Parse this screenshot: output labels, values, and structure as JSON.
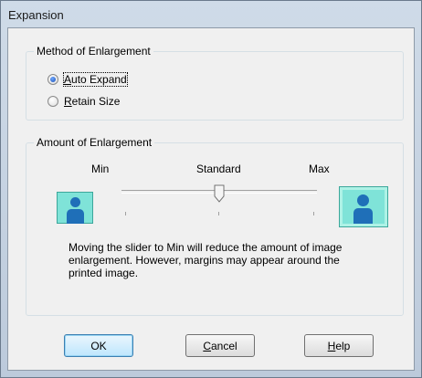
{
  "window": {
    "title": "Expansion"
  },
  "method_group": {
    "legend": "Method of Enlargement",
    "options": [
      {
        "label_accel": "A",
        "label_rest": "uto Expand",
        "selected": true
      },
      {
        "label_accel": "R",
        "label_rest": "etain Size",
        "selected": false
      }
    ]
  },
  "amount_group": {
    "legend": "Amount of Enlargement",
    "min_label": "Min",
    "standard_label": "Standard",
    "max_label": "Max",
    "slider_level": 0.5,
    "slider_positions": 3,
    "description": "Moving the slider to Min will reduce the amount of image enlargement. However, margins may appear around the printed image."
  },
  "buttons": {
    "ok": "OK",
    "cancel_accel": "C",
    "cancel_rest": "ancel",
    "help_accel": "H",
    "help_rest": "elp"
  },
  "colors": {
    "icon_fill": "#7fe3d8",
    "icon_figure": "#1f6fb8"
  }
}
